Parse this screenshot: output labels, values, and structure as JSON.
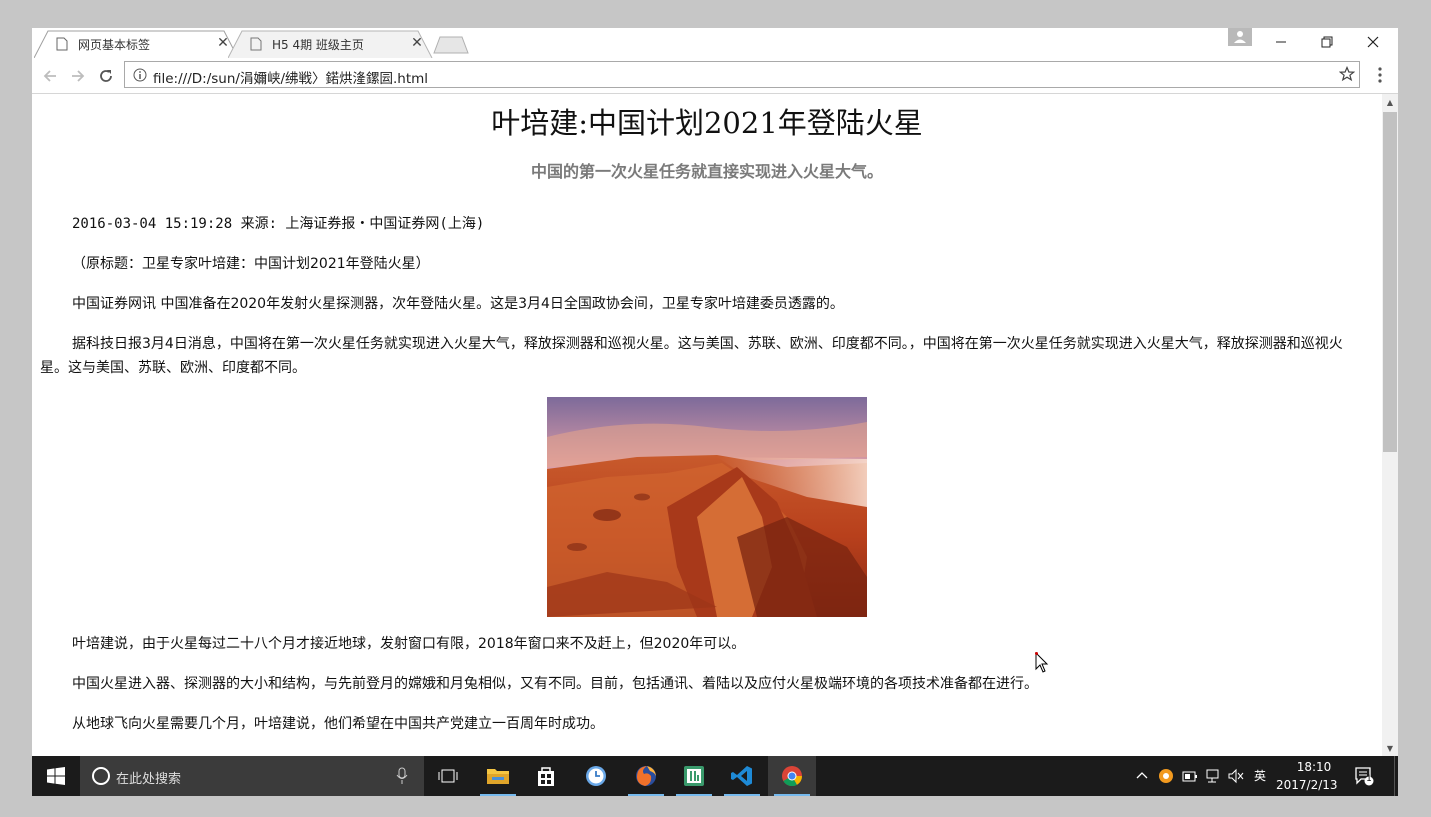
{
  "browser": {
    "tabs": [
      {
        "title": "网页基本标签",
        "active": true
      },
      {
        "title": "H5 4期 班级主页",
        "active": false
      }
    ],
    "url": "file:///D:/sun/涓嬭峡/绋戦〉鍩烘湰鏍囩.html"
  },
  "article": {
    "title": "叶培建:中国计划2021年登陆火星",
    "subtitle": "中国的第一次火星任务就直接实现进入火星大气。",
    "meta": "2016-03-04 15:19:28 来源: 上海证券报・中国证券网(上海)",
    "original_title": "（原标题：卫星专家叶培建：中国计划2021年登陆火星）",
    "paragraphs": [
      "中国证券网讯  中国准备在2020年发射火星探测器，次年登陆火星。这是3月4日全国政协会间，卫星专家叶培建委员透露的。",
      "据科技日报3月4日消息，中国将在第一次火星任务就实现进入火星大气，释放探测器和巡视火星。这与美国、苏联、欧洲、印度都不同。，中国将在第一次火星任务就实现进入火星大气，释放探测器和巡视火星。这与美国、苏联、欧洲、印度都不同。",
      "叶培建说，由于火星每过二十八个月才接近地球，发射窗口有限，2018年窗口来不及赶上，但2020年可以。",
      "中国火星进入器、探测器的大小和结构，与先前登月的嫦娥和月兔相似，又有不同。目前，包括通讯、着陆以及应付火星极端环境的各项技术准备都在进行。",
      "从地球飞向火星需要几个月，叶培建说，他们希望在中国共产党建立一百周年时成功。"
    ]
  },
  "taskbar": {
    "search_placeholder": "在此处搜索",
    "ime": "英",
    "time": "18:10",
    "date": "2017/2/13",
    "notification_count": "1"
  },
  "colors": {
    "taskbar": "#1b1b1b",
    "accent": "#76b9ed",
    "subtitle": "#7a7a7a"
  }
}
